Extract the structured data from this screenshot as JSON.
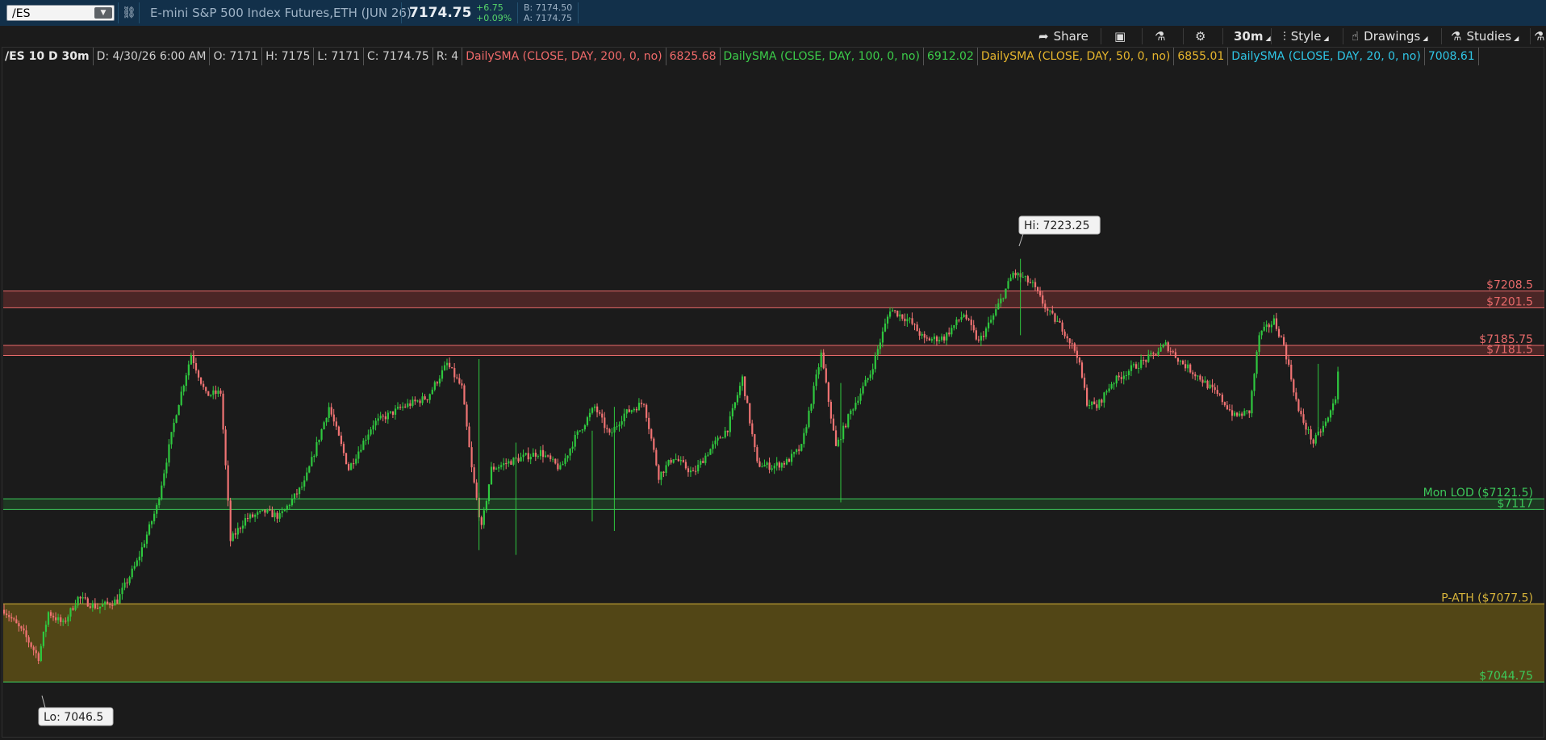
{
  "topbar": {
    "symbol": "/ES",
    "instrument": "E-mini S&P 500 Index Futures,ETH (JUN 26)",
    "last": "7174.75",
    "change": "+6.75",
    "change_pct": "+0.09%",
    "bid": "B: 7174.50",
    "ask": "A: 7174.75"
  },
  "toolbar": {
    "share": "Share",
    "timeframe": "30m",
    "style": "Style",
    "drawings": "Drawings",
    "studies": "Studies"
  },
  "studybar": {
    "chart_id": "/ES 10 D 30m",
    "date": "D: 4/30/26 6:00 AM",
    "open": "O: 7171",
    "high": "H: 7175",
    "low": "L: 7171",
    "close": "C: 7174.75",
    "range": "R: 4",
    "sma200_label": "DailySMA (CLOSE, DAY, 200, 0, no)",
    "sma200_value": "6825.68",
    "sma100_label": "DailySMA (CLOSE, DAY, 100, 0, no)",
    "sma100_value": "6912.02",
    "sma50_label": "DailySMA (CLOSE, DAY, 50, 0, no)",
    "sma50_value": "6855.01",
    "sma20_label": "DailySMA (CLOSE, DAY, 20, 0, no)",
    "sma20_value": "7008.61"
  },
  "colors": {
    "up": "#2fc83f",
    "down": "#f07373",
    "resistance": "#e86a6a",
    "support": "#3cc85a",
    "ath": "#d7b43a",
    "sma200": "#f06a6a",
    "sma100": "#3ccd4a",
    "sma50": "#e7b62d",
    "sma20": "#2fc6e6"
  },
  "chart_data": {
    "type": "candlestick",
    "ylim": [
      7040,
      7250
    ],
    "hi_label": "Hi: 7223.25",
    "lo_label": "Lo: 7046.5",
    "levels": [
      {
        "label": "$7208.5",
        "value": 7208.5,
        "kind": "resistance"
      },
      {
        "label": "$7201.5",
        "value": 7201.5,
        "kind": "resistance"
      },
      {
        "label": "$7185.75",
        "value": 7185.75,
        "kind": "resistance"
      },
      {
        "label": "$7181.5",
        "value": 7181.5,
        "kind": "resistance"
      },
      {
        "label": "Mon LOD ($7121.5)",
        "value": 7121.5,
        "kind": "support"
      },
      {
        "label": "$7117",
        "value": 7117,
        "kind": "support"
      },
      {
        "label": "P-ATH ($7077.5)",
        "value": 7077.5,
        "kind": "ath"
      },
      {
        "label": "$7044.75",
        "value": 7044.75,
        "kind": "support"
      }
    ],
    "zones": [
      {
        "from": 7201.5,
        "to": 7208.5,
        "kind": "resistance"
      },
      {
        "from": 7181.5,
        "to": 7185.75,
        "kind": "resistance"
      },
      {
        "from": 7117,
        "to": 7121.5,
        "kind": "support"
      },
      {
        "from": 7044.75,
        "to": 7077.5,
        "kind": "ath"
      }
    ],
    "path": [
      [
        0,
        7075
      ],
      [
        8,
        7065
      ],
      [
        14,
        7055
      ],
      [
        18,
        7074
      ],
      [
        24,
        7069
      ],
      [
        30,
        7080
      ],
      [
        38,
        7076
      ],
      [
        46,
        7079
      ],
      [
        54,
        7095
      ],
      [
        62,
        7118
      ],
      [
        70,
        7158
      ],
      [
        76,
        7182
      ],
      [
        82,
        7165
      ],
      [
        88,
        7166
      ],
      [
        92,
        7104
      ],
      [
        98,
        7113
      ],
      [
        106,
        7116
      ],
      [
        112,
        7114
      ],
      [
        122,
        7128
      ],
      [
        132,
        7160
      ],
      [
        140,
        7134
      ],
      [
        150,
        7153
      ],
      [
        162,
        7160
      ],
      [
        172,
        7164
      ],
      [
        180,
        7178
      ],
      [
        186,
        7168
      ],
      [
        190,
        7134
      ],
      [
        194,
        7109
      ],
      [
        198,
        7134
      ],
      [
        208,
        7138
      ],
      [
        218,
        7141
      ],
      [
        226,
        7134
      ],
      [
        232,
        7147
      ],
      [
        240,
        7160
      ],
      [
        246,
        7148
      ],
      [
        252,
        7157
      ],
      [
        260,
        7162
      ],
      [
        266,
        7131
      ],
      [
        272,
        7139
      ],
      [
        280,
        7132
      ],
      [
        286,
        7141
      ],
      [
        294,
        7151
      ],
      [
        300,
        7172
      ],
      [
        306,
        7136
      ],
      [
        312,
        7135
      ],
      [
        318,
        7137
      ],
      [
        324,
        7143
      ],
      [
        332,
        7182
      ],
      [
        338,
        7143
      ],
      [
        344,
        7158
      ],
      [
        352,
        7174
      ],
      [
        360,
        7201
      ],
      [
        368,
        7196
      ],
      [
        374,
        7188
      ],
      [
        382,
        7189
      ],
      [
        390,
        7199
      ],
      [
        396,
        7187
      ],
      [
        402,
        7198
      ],
      [
        410,
        7216
      ],
      [
        414,
        7214
      ],
      [
        418,
        7211
      ],
      [
        424,
        7200
      ],
      [
        430,
        7193
      ],
      [
        436,
        7182
      ],
      [
        440,
        7162
      ],
      [
        444,
        7160
      ],
      [
        450,
        7170
      ],
      [
        458,
        7176
      ],
      [
        466,
        7181
      ],
      [
        472,
        7186
      ],
      [
        478,
        7179
      ],
      [
        486,
        7172
      ],
      [
        494,
        7164
      ],
      [
        500,
        7156
      ],
      [
        506,
        7158
      ],
      [
        510,
        7190
      ],
      [
        516,
        7196
      ],
      [
        520,
        7186
      ],
      [
        526,
        7158
      ],
      [
        532,
        7145
      ],
      [
        538,
        7155
      ],
      [
        542,
        7167
      ]
    ]
  }
}
